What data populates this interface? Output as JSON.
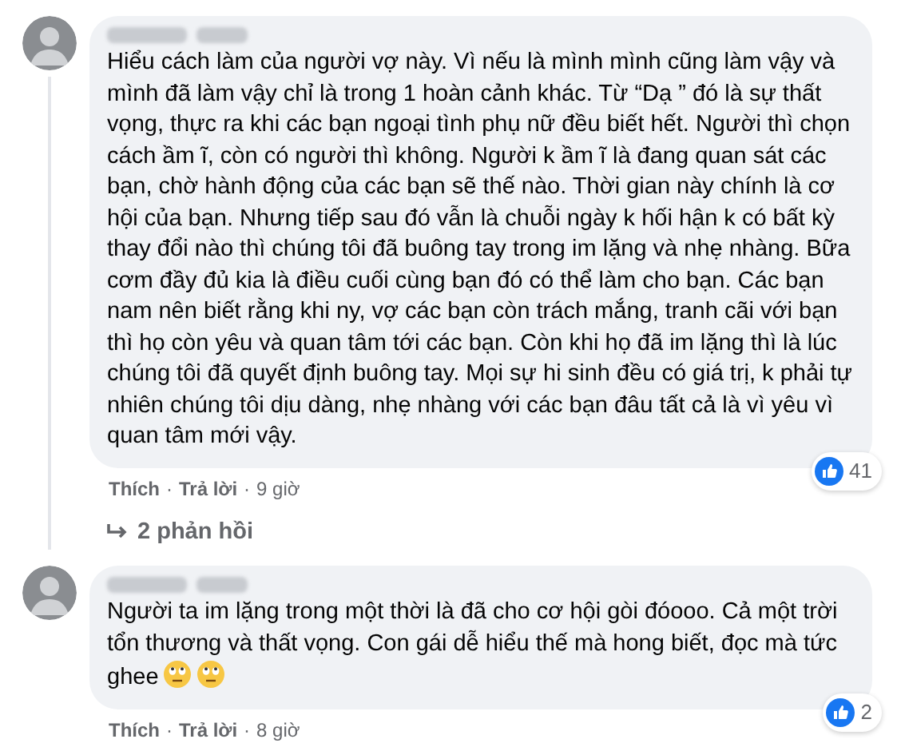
{
  "comments": [
    {
      "text": "Hiểu cách làm của người vợ này. Vì nếu là mình mình cũng làm vậy và mình đã làm vậy chỉ là trong 1 hoàn cảnh khác. Từ “Dạ ” đó là sự thất vọng, thực ra khi các bạn ngoại tình phụ nữ đều biết hết. Người thì chọn cách ầm ĩ, còn có người thì không. Người k ầm ĩ là đang quan sát các bạn, chờ hành động của các bạn sẽ thế nào. Thời gian này chính là cơ hội của bạn. Nhưng tiếp sau đó vẫn là chuỗi ngày k hối hận k có bất kỳ thay đổi nào thì chúng tôi đã buông tay trong im lặng và nhẹ nhàng. Bữa cơm đầy đủ kia là điều cuối cùng bạn đó có thể làm cho bạn. Các bạn nam nên biết rằng khi ny, vợ các bạn còn trách mắng, tranh cãi với bạn thì họ còn yêu và quan tâm tới các bạn. Còn khi họ đã im lặng thì là lúc chúng tôi đã quyết định buông tay. Mọi sự hi sinh đều có giá trị, k phải tự nhiên chúng tôi dịu dàng, nhẹ nhàng với các bạn đâu tất cả là vì yêu vì quan tâm mới vậy.",
      "like": "Thích",
      "separator_1": "·",
      "reply": "Trả lời",
      "separator_2": "·",
      "time": "9 giờ",
      "reaction_count": "41",
      "replies": "2 phản hồi"
    },
    {
      "text": "Người ta im lặng trong một thời là đã cho cơ hội gòi đóooo. Cả một trời tổn thương và thất vọng. Con gái dễ hiểu thế mà hong biết, đọc mà tức ghee",
      "emojis": [
        {
          "kind": "eye-roll"
        },
        {
          "kind": "eye-roll"
        }
      ],
      "like": "Thích",
      "separator_1": "·",
      "reply": "Trả lời",
      "separator_2": "·",
      "time": "8 giờ",
      "reaction_count": "2"
    }
  ]
}
